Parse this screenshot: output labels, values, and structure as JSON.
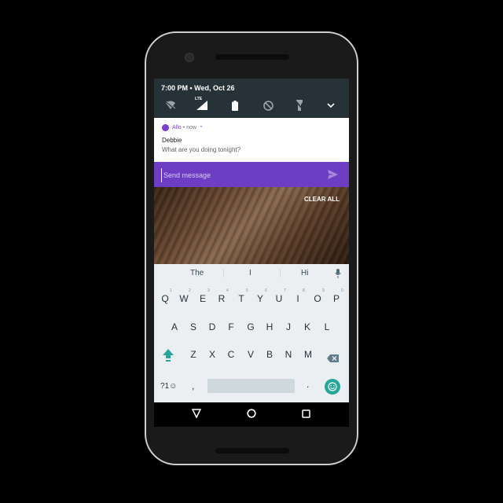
{
  "status": {
    "time": "7:00 PM • Wed, Oct 26",
    "quick_settings": [
      "wifi-icon",
      "signal-lte-icon",
      "battery-icon",
      "do-not-disturb-icon",
      "flashlight-icon",
      "expand-icon"
    ],
    "lte_label": "LTE"
  },
  "notification": {
    "app": "Allo",
    "meta": "• now",
    "sender": "Debbie",
    "message": "What are you doing tonight?"
  },
  "reply": {
    "placeholder": "Send message",
    "value": ""
  },
  "clear_all": "CLEAR ALL",
  "keyboard": {
    "suggestions": [
      "The",
      "I",
      "Hi"
    ],
    "row1": [
      "Q",
      "W",
      "E",
      "R",
      "T",
      "Y",
      "U",
      "I",
      "O",
      "P"
    ],
    "row1_hints": [
      "1",
      "2",
      "3",
      "4",
      "5",
      "6",
      "7",
      "8",
      "9",
      "0"
    ],
    "row2": [
      "A",
      "S",
      "D",
      "F",
      "G",
      "H",
      "J",
      "K",
      "L"
    ],
    "row3": [
      "Z",
      "X",
      "C",
      "V",
      "B",
      "N",
      "M"
    ],
    "symbols": "?1☺",
    "comma": ",",
    "period": "."
  },
  "colors": {
    "accent": "#6d3ec4",
    "status_bar": "#263238",
    "emoji_key": "#26a69a"
  }
}
